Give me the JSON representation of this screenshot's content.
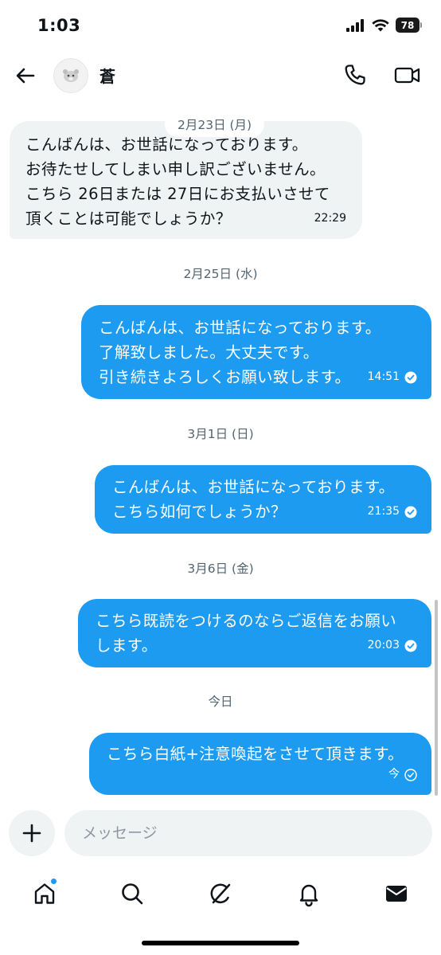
{
  "status_bar": {
    "time": "1:03",
    "battery": "78",
    "icons": [
      "cellular-signal-icon",
      "wifi-icon",
      "battery-icon"
    ]
  },
  "header": {
    "contact_name": "蒼",
    "icons": [
      "back-arrow-icon",
      "avatar",
      "phone-icon",
      "video-camera-icon"
    ]
  },
  "thread": {
    "dates": [
      "2月23日 (月)",
      "2月25日 (水)",
      "3月1日 (日)",
      "3月6日 (金)",
      "今日"
    ],
    "messages": [
      {
        "direction": "incoming",
        "lines": [
          "こんばんは、お世話になっております。",
          "お待たせしてしまい申し訳ございません。",
          "こちら 26日または 27日にお支払いさせて",
          "頂くことは可能でしょうか？"
        ],
        "time": "22:29"
      },
      {
        "direction": "outgoing",
        "lines": [
          "こんばんは、お世話になっております。",
          "了解致しました。大丈夫です。",
          "引き続きよろしくお願い致します。"
        ],
        "time": "14:51",
        "status": "sent"
      },
      {
        "direction": "outgoing",
        "lines": [
          "こんばんは、お世話になっております。",
          "こちら如何でしょうか？"
        ],
        "time": "21:35",
        "status": "sent"
      },
      {
        "direction": "outgoing",
        "lines": [
          "こちら既読をつけるのならご返信をお願い",
          "します。"
        ],
        "time": "20:03",
        "status": "sent"
      },
      {
        "direction": "outgoing",
        "lines": [
          "こちら白紙+注意喚起をさせて頂きます。"
        ],
        "time": "今",
        "status": "pending"
      }
    ]
  },
  "composer": {
    "placeholder": "メッセージ",
    "value": ""
  },
  "bottom_nav": {
    "items": [
      "home-icon",
      "search-icon",
      "grok-icon",
      "notifications-bell-icon",
      "messages-envelope-icon"
    ]
  },
  "colors": {
    "accent": "#1d9bf0",
    "incoming_bubble": "#eff3f4",
    "text_secondary": "#536471"
  }
}
